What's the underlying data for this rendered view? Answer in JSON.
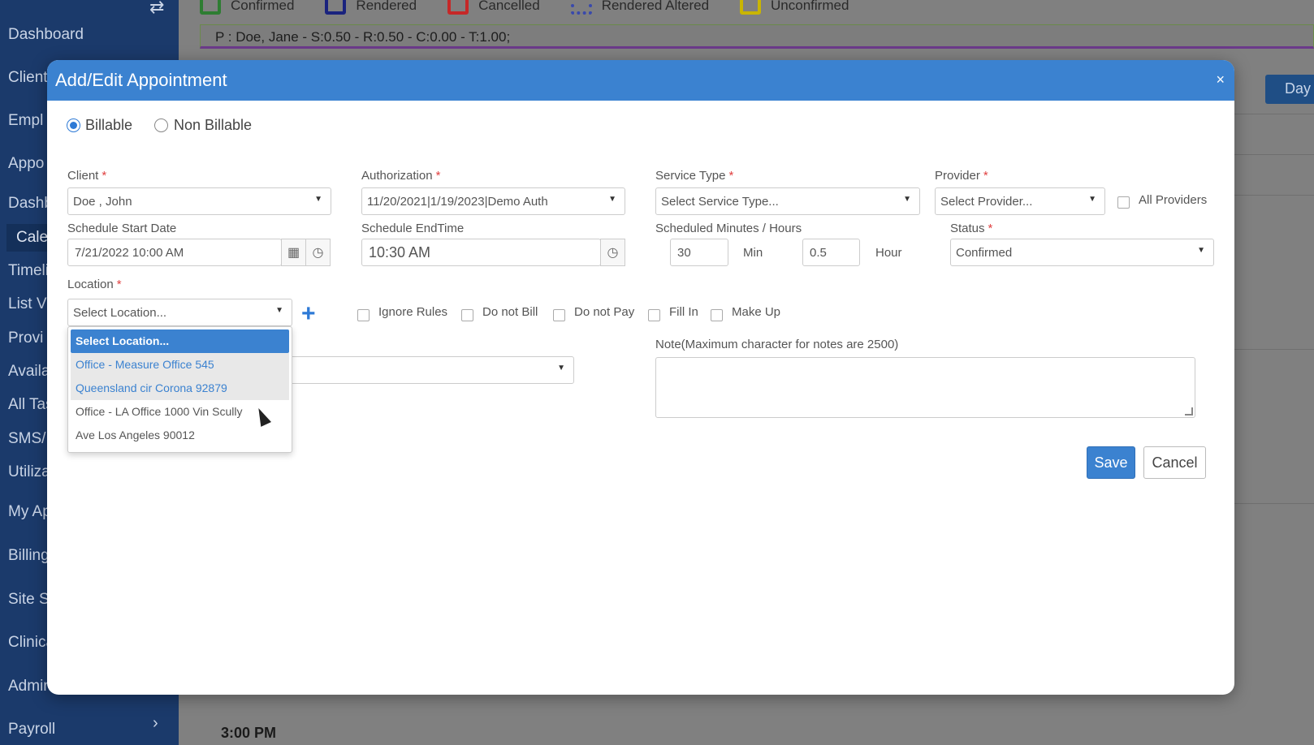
{
  "sidebar": {
    "items": [
      "Dashboard",
      "Clients",
      "Empl",
      "Appo",
      "Dashb",
      "Cale",
      "Timeli",
      "List Vi",
      "Provi",
      "Availa",
      "All Tas",
      "SMS/E",
      "Utiliza",
      "My Ap",
      "Billing",
      "Site Se",
      "Clinica",
      "Admin",
      "Payroll"
    ],
    "toggle_icon": "⇄",
    "payroll_chevron": "›"
  },
  "legend": {
    "items": [
      {
        "label": "Confirmed",
        "color": "#2e7d32"
      },
      {
        "label": "Rendered",
        "color": "#1a237e"
      },
      {
        "label": "Cancelled",
        "color": "#c62828"
      },
      {
        "label": "Rendered Altered",
        "color": "#3949ab"
      },
      {
        "label": "Unconfirmed",
        "color": "#c9b500"
      }
    ]
  },
  "info_bar": "P : Doe, Jane - S:0.50 - R:0.50 - C:0.00 - T:1.00;",
  "day_button": "Day",
  "time_label": "3:00 PM",
  "modal": {
    "title": "Add/Edit Appointment",
    "close_icon": "×",
    "billing": {
      "billable": "Billable",
      "non_billable": "Non Billable",
      "selected": "Billable"
    },
    "client": {
      "label": "Client",
      "value": "Doe , John"
    },
    "authorization": {
      "label": "Authorization",
      "value": "11/20/2021|1/19/2023|Demo Auth"
    },
    "service_type": {
      "label": "Service Type",
      "value": "Select Service Type..."
    },
    "provider": {
      "label": "Provider",
      "value": "Select Provider..."
    },
    "all_providers": "All Providers",
    "start_date": {
      "label": "Schedule Start Date",
      "value": "7/21/2022 10:00 AM"
    },
    "end_time": {
      "label": "Schedule EndTime",
      "value": "10:30 AM"
    },
    "scheduled": {
      "label": "Scheduled Minutes / Hours",
      "minutes": "30",
      "min_label": "Min",
      "hours": "0.5",
      "hour_label": "Hour"
    },
    "status": {
      "label": "Status",
      "value": "Confirmed"
    },
    "location": {
      "label": "Location",
      "value": "Select Location...",
      "options": [
        "Select Location...",
        "Office - Measure Office 545",
        "Queensland cir Corona 92879",
        "Office - LA Office 1000 Vin Scully",
        "Ave Los Angeles 90012"
      ]
    },
    "add_icon": "+",
    "flags": [
      "Ignore Rules",
      "Do not Bill",
      "Do not Pay",
      "Fill In",
      "Make Up"
    ],
    "note_label": "Note(Maximum character for notes are 2500)",
    "save": "Save",
    "cancel": "Cancel"
  }
}
